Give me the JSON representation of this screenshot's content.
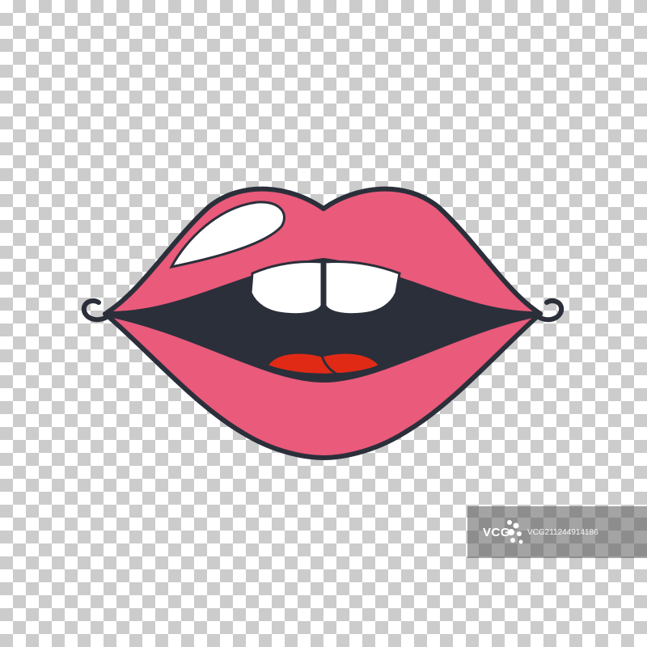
{
  "illustration": {
    "subject": "lips",
    "colors": {
      "outline": "#2b2f3a",
      "lips": "#e95a7b",
      "mouth_interior": "#2b2f3a",
      "teeth": "#ffffff",
      "tongue": "#e12a16",
      "highlight": "#ffffff"
    }
  },
  "watermark": {
    "brand": "VCG",
    "id_text": "VCG211244914186"
  }
}
